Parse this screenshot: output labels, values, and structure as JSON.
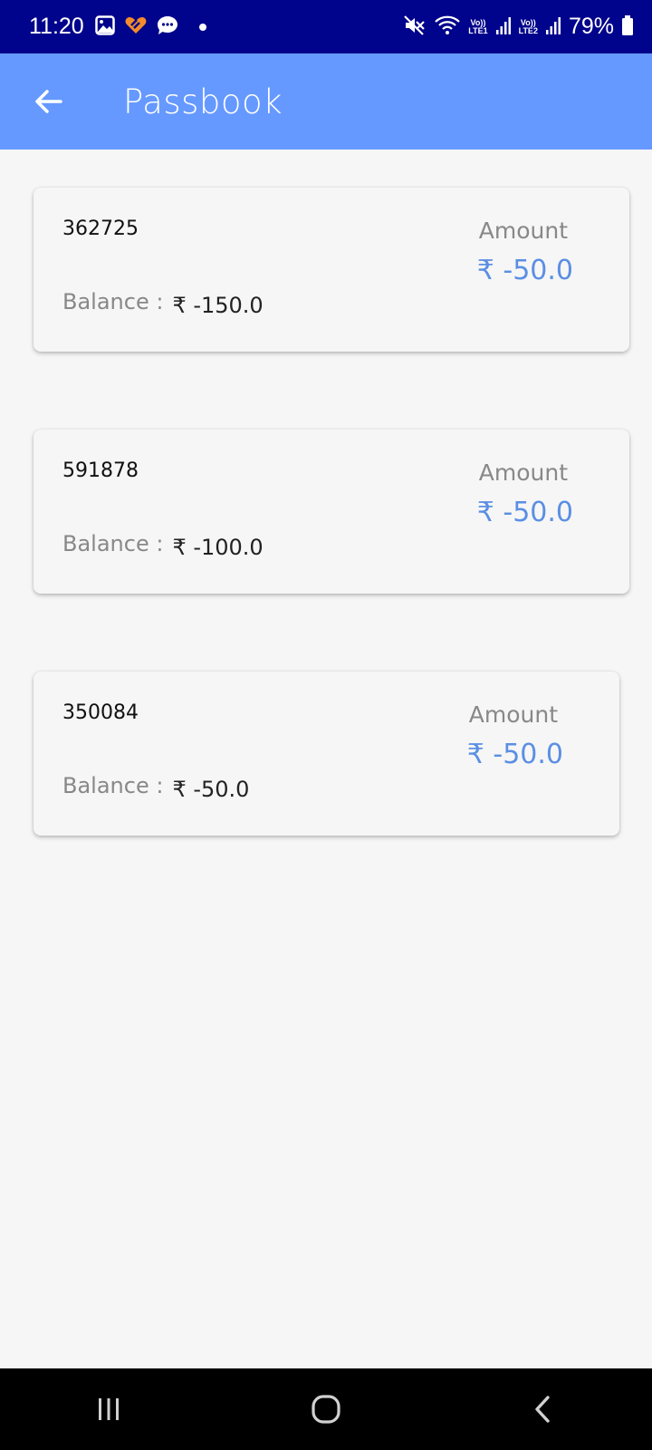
{
  "status_bar": {
    "time": "11:20",
    "battery": "79%",
    "sim1_label_top": "Vo))",
    "sim1_label_bottom": "LTE1",
    "sim2_label_top": "Vo))",
    "sim2_label_bottom": "LTE2",
    "left_icons": [
      "gallery-icon",
      "app-notification-icon",
      "chat-icon",
      "dot-icon"
    ],
    "right_icons": [
      "mute-icon",
      "wifi-icon",
      "signal-icon",
      "signal-icon",
      "battery-icon"
    ]
  },
  "app_bar": {
    "title": "Passbook",
    "back_icon": "arrow-left-icon",
    "color": "#6699ff"
  },
  "transactions": [
    {
      "id": "362725",
      "amount_label": "Amount",
      "amount": "₹ -50.0",
      "balance_label": "Balance :",
      "balance": "₹ -150.0"
    },
    {
      "id": "591878",
      "amount_label": "Amount",
      "amount": "₹ -50.0",
      "balance_label": "Balance :",
      "balance": "₹ -100.0"
    },
    {
      "id": "350084",
      "amount_label": "Amount",
      "amount": "₹ -50.0",
      "balance_label": "Balance :",
      "balance": "₹ -50.0"
    }
  ],
  "colors": {
    "status_bar": "#00038b",
    "accent": "#5b8fe3",
    "background": "#f6f6f6"
  },
  "nav_bar": {
    "icons": [
      "recents-icon",
      "home-icon",
      "back-icon"
    ]
  }
}
